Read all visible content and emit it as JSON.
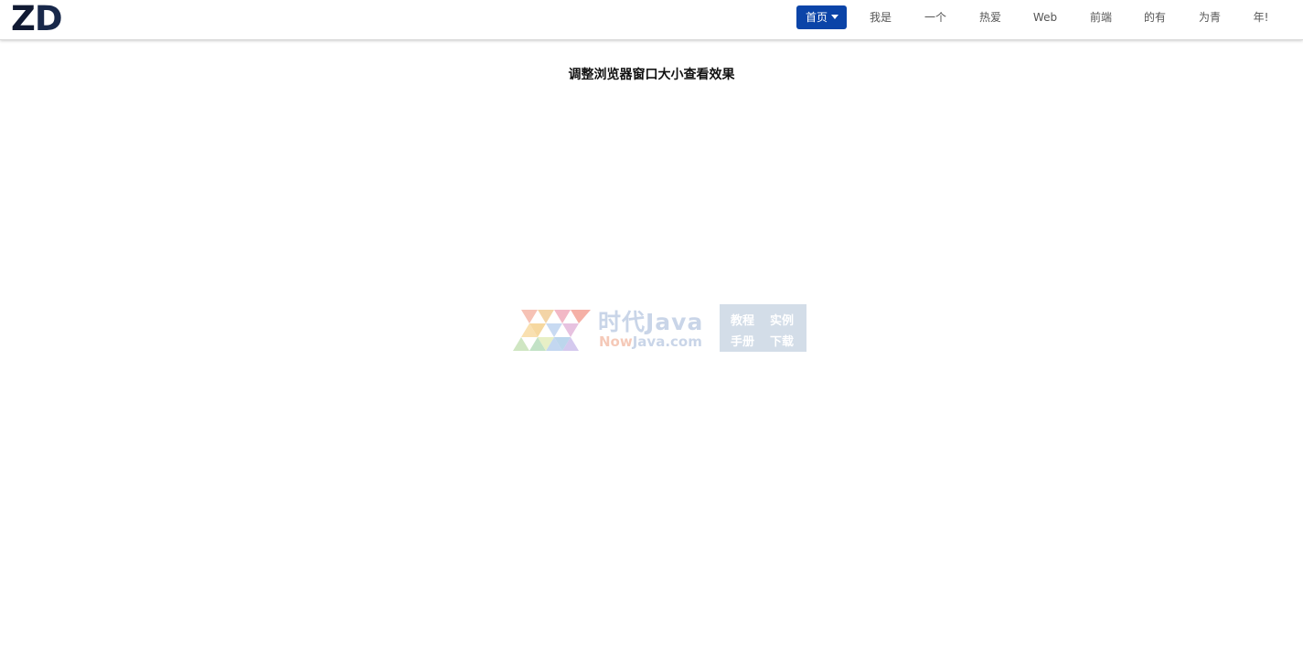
{
  "logo": {
    "letter1": "Z",
    "letter2": "D"
  },
  "nav": {
    "items": [
      {
        "label": "首页",
        "active": true
      },
      {
        "label": "我是"
      },
      {
        "label": "一个"
      },
      {
        "label": "热爱"
      },
      {
        "label": "Web"
      },
      {
        "label": "前端"
      },
      {
        "label": "的有"
      },
      {
        "label": "为青"
      },
      {
        "label": "年!"
      }
    ]
  },
  "main": {
    "title": "调整浏览器窗口大小查看效果"
  },
  "watermark": {
    "name": "时代Java",
    "site_now": "Now",
    "site_rest": "Java.com",
    "box": [
      "教程",
      "实例",
      "手册",
      "下载"
    ]
  },
  "colors": {
    "accent": "#0b44a8",
    "nav_text": "#555555",
    "title": "#111111"
  }
}
